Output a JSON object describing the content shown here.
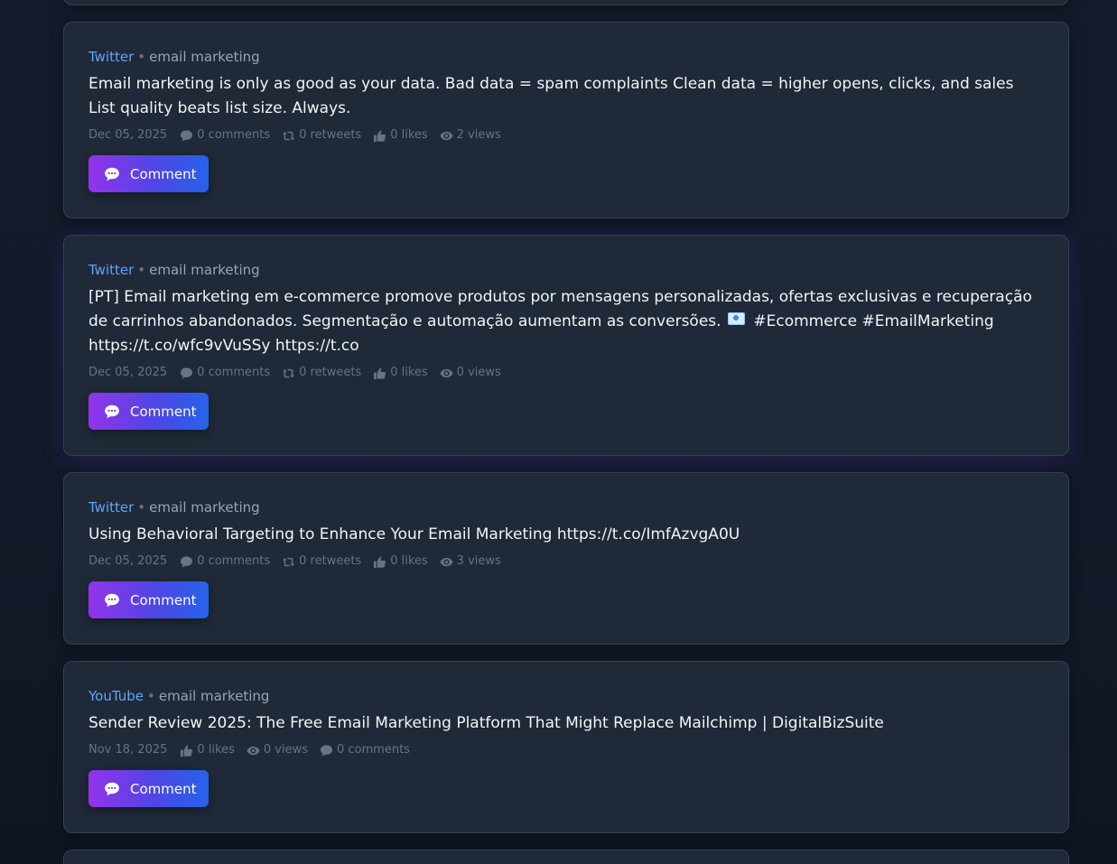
{
  "posts": [
    {
      "platform": "Twitter",
      "topic": "email marketing",
      "text": "Email marketing is only as good as your data. Bad data = spam complaints Clean data = higher opens, clicks, and sales List quality beats list size. Always.",
      "date": "Dec 05, 2025",
      "comments": "0 comments",
      "retweets": "0 retweets",
      "likes": "0 likes",
      "views": "2 views",
      "button_label": "Comment"
    },
    {
      "platform": "Twitter",
      "topic": "email marketing",
      "text_before_flag": "[PT] Email marketing em e-commerce promove produtos por mensagens personalizadas, ofertas exclusivas e recuperação de carrinhos abandonados. Segmentação e automação aumentam as conversões.",
      "text_after_flag": "#Ecommerce #EmailMarketing https://t.co/wfc9vVuSSy https://t.co",
      "date": "Dec 05, 2025",
      "comments": "0 comments",
      "retweets": "0 retweets",
      "likes": "0 likes",
      "views": "0 views",
      "button_label": "Comment"
    },
    {
      "platform": "Twitter",
      "topic": "email marketing",
      "text": "Using Behavioral Targeting to Enhance Your Email Marketing https://t.co/ImfAzvgA0U",
      "date": "Dec 05, 2025",
      "comments": "0 comments",
      "retweets": "0 retweets",
      "likes": "0 likes",
      "views": "3 views",
      "button_label": "Comment"
    },
    {
      "platform": "YouTube",
      "topic": "email marketing",
      "text": "Sender Review 2025: The Free Email Marketing Platform That Might Replace Mailchimp | DigitalBizSuite",
      "date": "Nov 18, 2025",
      "likes": "0 likes",
      "views": "0 views",
      "comments": "0 comments",
      "button_label": "Comment"
    }
  ],
  "colors": {
    "background": "#111827",
    "card": "#1f2937",
    "platform_link": "#60a5fa",
    "button_gradient_start": "#9333ea",
    "button_gradient_end": "#2563eb"
  },
  "icons": [
    "comment-bubble-icon",
    "retweet-icon",
    "thumbs-up-icon",
    "eye-icon"
  ]
}
